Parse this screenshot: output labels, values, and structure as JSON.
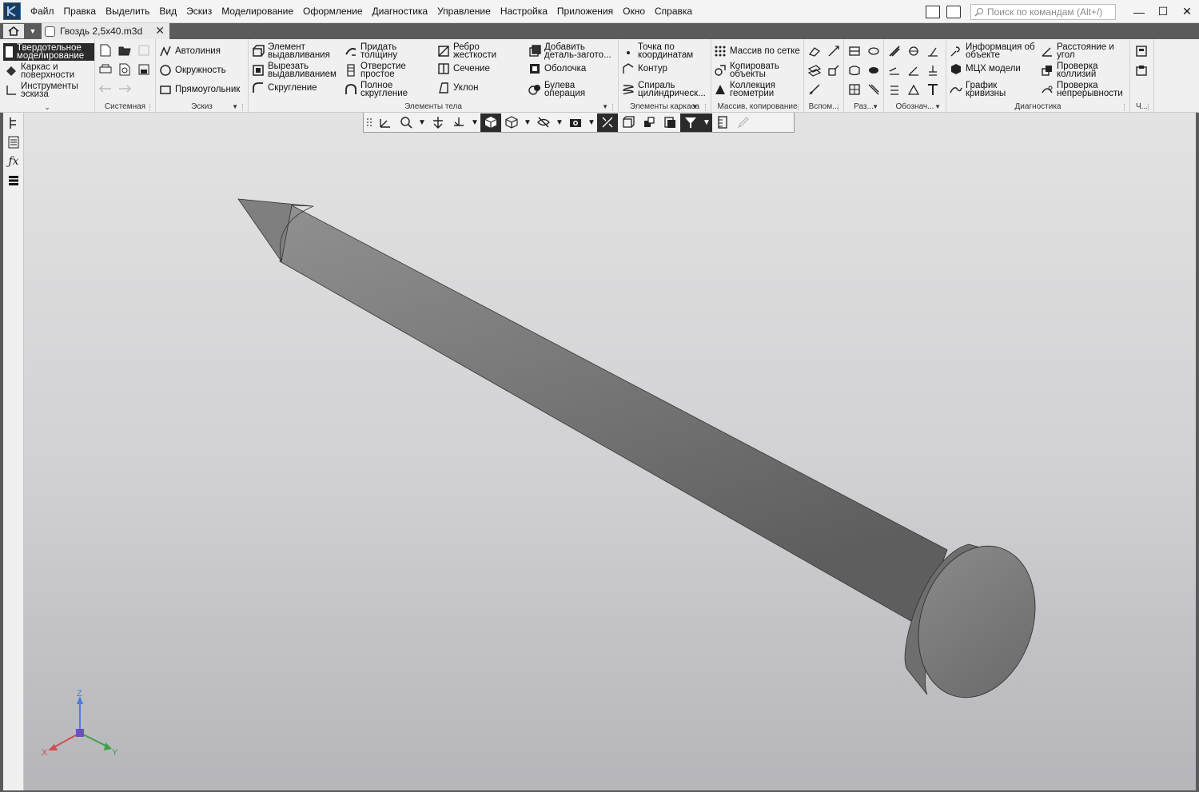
{
  "menu": [
    "Файл",
    "Правка",
    "Выделить",
    "Вид",
    "Эскиз",
    "Моделирование",
    "Оформление",
    "Диагностика",
    "Управление",
    "Настройка",
    "Приложения",
    "Окно",
    "Справка"
  ],
  "search": {
    "placeholder": "Поиск по командам (Alt+/)"
  },
  "tab": {
    "label": "Гвоздь 2,5x40.m3d",
    "close": "✕"
  },
  "modes": [
    "Твердотельное моделирование",
    "Каркас и поверхности",
    "Инструменты эскиза"
  ],
  "groups": {
    "system": "Системная",
    "sketch": "Эскиз",
    "body": "Элементы тела",
    "frame": "Элементы каркаса",
    "array": "Массив, копирование",
    "aux": "Вспом...",
    "sect": "Раз...",
    "marks": "Обознач...",
    "diag": "Диагностика",
    "extra": "Ч..."
  },
  "sketch_tools": [
    "Автолиния",
    "Окружность",
    "Прямоугольник"
  ],
  "body_tools": {
    "col1": [
      "Элемент выдавливания",
      "Вырезать выдавливанием",
      "Скругление"
    ],
    "col2": [
      "Придать толщину",
      "Отверстие простое",
      "Полное скругление"
    ],
    "col3": [
      "Ребро жесткости",
      "Сечение",
      "Уклон"
    ],
    "col4": [
      "Добавить деталь-загото...",
      "Оболочка",
      "Булева операция"
    ]
  },
  "frame_tools": [
    "Точка по координатам",
    "Контур",
    "Спираль цилиндрическ..."
  ],
  "array_tools": [
    "Массив по сетке",
    "Копировать объекты",
    "Коллекция геометрии"
  ],
  "diag_tools": {
    "col1": [
      "Информация об объекте",
      "МЦХ модели",
      "График кривизны"
    ],
    "col2": [
      "Расстояние и угол",
      "Проверка коллизий",
      "Проверка непрерывности"
    ]
  },
  "axes": {
    "x": "X",
    "y": "Y",
    "z": "Z"
  },
  "colors": {
    "active": "#2b2b2b",
    "model": "#7a7a7a",
    "ribbon": "#f0f0f0"
  }
}
